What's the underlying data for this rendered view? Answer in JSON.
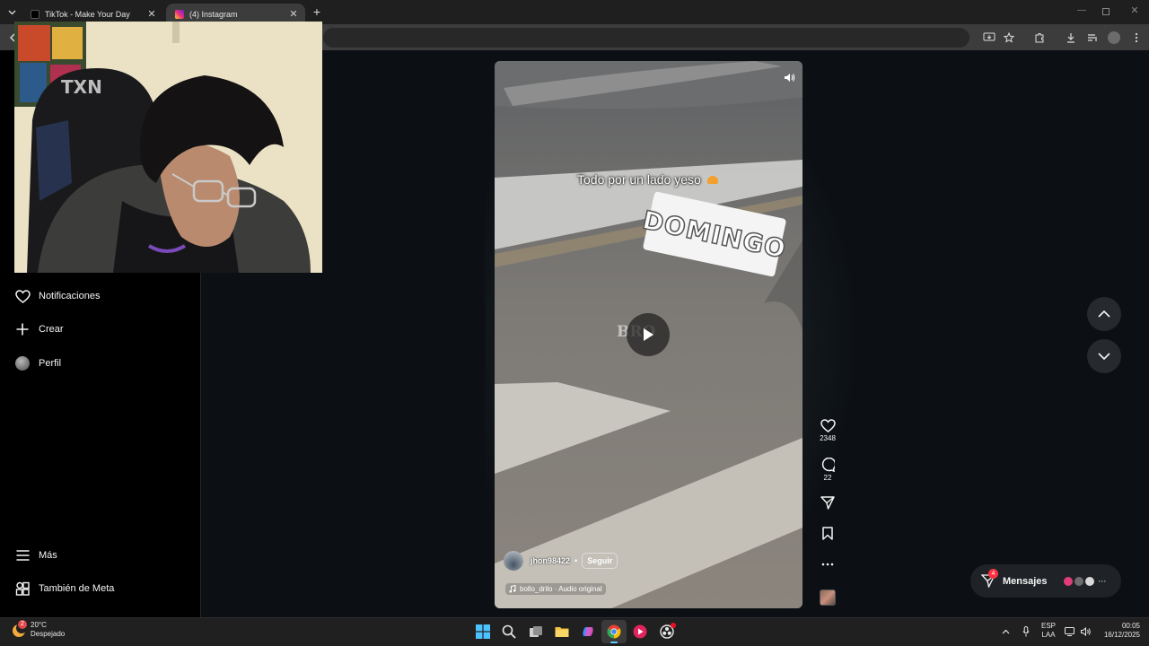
{
  "browser": {
    "tabs": [
      {
        "label": "TikTok - Make Your Day"
      },
      {
        "label": "(4) Instagram"
      }
    ]
  },
  "sidebar": {
    "items": [
      {
        "label": "Notificaciones",
        "icon": "heart-icon"
      },
      {
        "label": "Crear",
        "icon": "plus-icon"
      },
      {
        "label": "Perfil",
        "icon": "avatar"
      },
      {
        "label": "Más",
        "icon": "menu-icon"
      },
      {
        "label": "También de Meta",
        "icon": "meta-apps-icon"
      }
    ]
  },
  "webcam": {
    "chair_brand": "TXN"
  },
  "reel": {
    "caption_overlay": "Todo por un lado yeso",
    "sticker_text": "DOMINGO",
    "watermark_partial": "BRO",
    "username": "jhon98422",
    "follow_label": "Seguir",
    "audio": "bollo_drilo · Audio original",
    "likes": "2348",
    "comments": "22"
  },
  "messages": {
    "label": "Mensajes",
    "badge": "4"
  },
  "taskbar": {
    "weather_temp": "20°C",
    "weather_desc": "Despejado",
    "weather_badge": "2",
    "lang_top": "ESP",
    "lang_bottom": "LAA",
    "time": "00:05",
    "date": "16/12/2025"
  },
  "colors": {
    "page_bg": "#0c1014",
    "accent_red": "#ff3040",
    "taskbar_bg": "#202020"
  }
}
